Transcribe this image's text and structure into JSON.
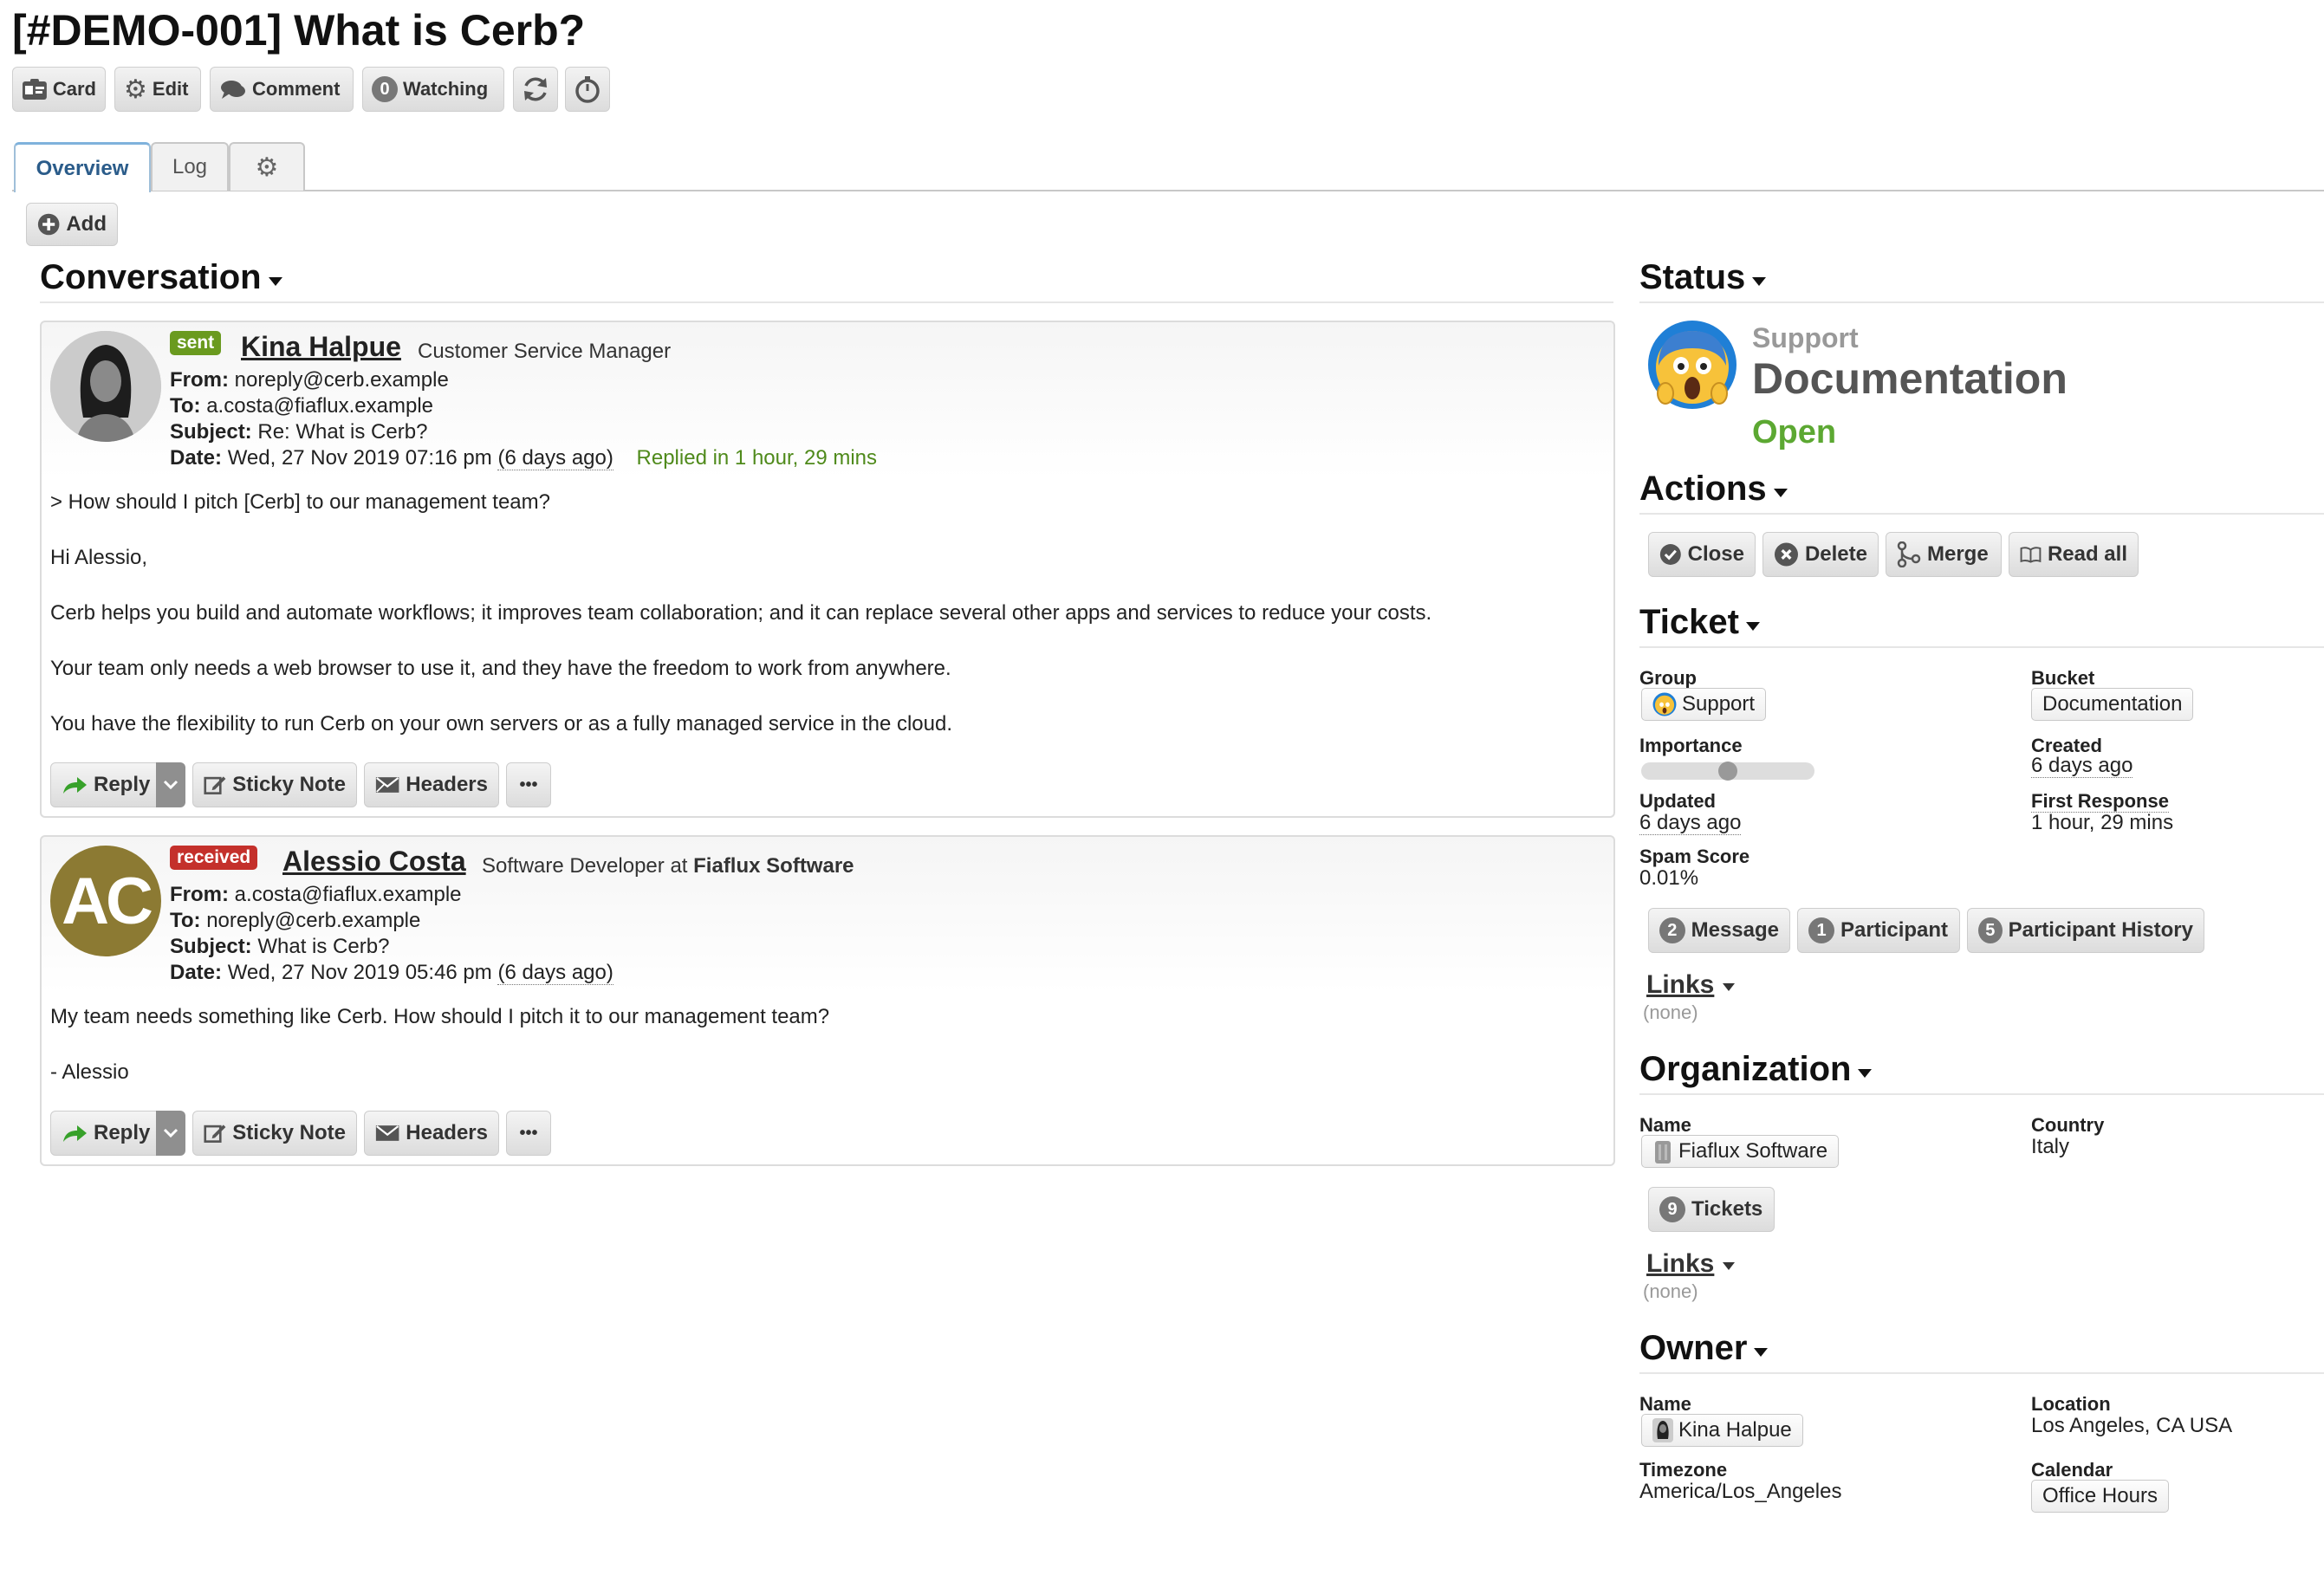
{
  "page": {
    "title": "[#DEMO-001] What is Cerb?"
  },
  "toolbar": {
    "card": "Card",
    "edit": "Edit",
    "comment": "Comment",
    "watching_count": "0",
    "watching": "Watching"
  },
  "tabs": {
    "overview": "Overview",
    "log": "Log"
  },
  "add_label": "Add",
  "conversation": {
    "heading": "Conversation",
    "messages": [
      {
        "badge": "sent",
        "badge_color": "#6a9a1f",
        "sender": "Kina Halpue",
        "role": "Customer Service Manager",
        "from_label": "From:",
        "from": "noreply@cerb.example",
        "to_label": "To:",
        "to": "a.costa@fiaflux.example",
        "subject_label": "Subject:",
        "subject": "Re: What is Cerb?",
        "date_label": "Date:",
        "date": "Wed, 27 Nov 2019 07:16 pm",
        "ago": "(6 days ago)",
        "replied": "Replied in 1 hour, 29 mins",
        "body": [
          "> How should I pitch [Cerb] to our management team?",
          "Hi Alessio,",
          "Cerb helps you build and automate workflows; it improves team collaboration; and it can replace several other apps and services to reduce your costs.",
          "Your team only needs a web browser to use it, and they have the freedom to work from anywhere.",
          "You have the flexibility to run Cerb on your own servers or as a fully managed service in the cloud."
        ]
      },
      {
        "badge": "received",
        "badge_color": "#c4302b",
        "sender": "Alessio Costa",
        "role_prefix": "Software Developer at",
        "org": "Fiaflux Software",
        "avatar_initials": "AC",
        "avatar_color": "#8c7a33",
        "from_label": "From:",
        "from": "a.costa@fiaflux.example",
        "to_label": "To:",
        "to": "noreply@cerb.example",
        "subject_label": "Subject:",
        "subject": "What is Cerb?",
        "date_label": "Date:",
        "date": "Wed, 27 Nov 2019 05:46 pm",
        "ago": "(6 days ago)",
        "body": [
          "My team needs something like Cerb. How should I pitch it to our management team?",
          "- Alessio"
        ]
      }
    ],
    "actions": {
      "reply": "Reply",
      "sticky": "Sticky Note",
      "headers": "Headers",
      "more": "•••"
    }
  },
  "status": {
    "heading": "Status",
    "group": "Support",
    "bucket": "Documentation",
    "state": "Open",
    "state_color": "#5ca832"
  },
  "actions": {
    "heading": "Actions",
    "close": "Close",
    "delete": "Delete",
    "merge": "Merge",
    "read_all": "Read all"
  },
  "ticket": {
    "heading": "Ticket",
    "group_label": "Group",
    "group": "Support",
    "bucket_label": "Bucket",
    "bucket": "Documentation",
    "importance_label": "Importance",
    "importance_value": 0.5,
    "created_label": "Created",
    "created": "6 days ago",
    "updated_label": "Updated",
    "updated": "6 days ago",
    "first_response_label": "First Response",
    "first_response": "1 hour, 29 mins",
    "spam_label": "Spam Score",
    "spam": "0.01%",
    "message_count": "2",
    "message": "Message",
    "participant_count": "1",
    "participant": "Participant",
    "history_count": "5",
    "history": "Participant History",
    "links_label": "Links",
    "links_none": "(none)"
  },
  "organization": {
    "heading": "Organization",
    "name_label": "Name",
    "name": "Fiaflux Software",
    "country_label": "Country",
    "country": "Italy",
    "tickets_count": "9",
    "tickets": "Tickets",
    "links_label": "Links",
    "links_none": "(none)"
  },
  "owner": {
    "heading": "Owner",
    "name_label": "Name",
    "name": "Kina Halpue",
    "location_label": "Location",
    "location": "Los Angeles, CA USA",
    "timezone_label": "Timezone",
    "timezone": "America/Los_Angeles",
    "calendar_label": "Calendar",
    "calendar": "Office Hours"
  }
}
